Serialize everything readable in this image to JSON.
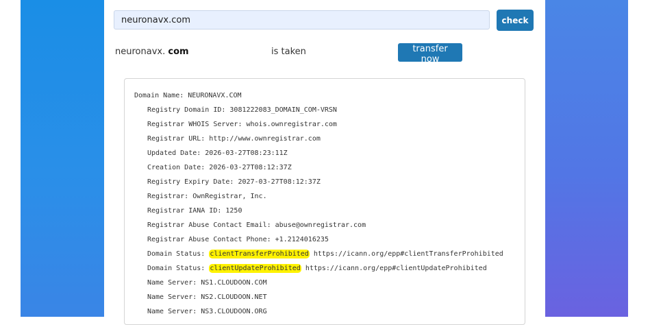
{
  "search": {
    "value": "neuronavx.com",
    "button_label": "check"
  },
  "result": {
    "domain_prefix": "neuronavx.",
    "domain_tld": "com",
    "status": "is taken",
    "transfer_label": "transfer now"
  },
  "whois": {
    "first_line": "Domain Name: NEURONAVX.COM",
    "lines": [
      "Registry Domain ID: 3081222083_DOMAIN_COM-VRSN",
      "Registrar WHOIS Server: whois.ownregistrar.com",
      "Registrar URL: http://www.ownregistrar.com",
      "Updated Date: 2026-03-27T08:23:11Z",
      "Creation Date: 2026-03-27T08:12:37Z",
      "Registry Expiry Date: 2027-03-27T08:12:37Z",
      "Registrar: OwnRegistrar, Inc.",
      "Registrar IANA ID: 1250",
      "Registrar Abuse Contact Email: abuse@ownregistrar.com",
      "Registrar Abuse Contact Phone: +1.2124016235"
    ],
    "status_lines": [
      {
        "label": "Domain Status:",
        "code": "clientTransferProhibited",
        "url": "https://icann.org/epp#clientTransferProhibited"
      },
      {
        "label": "Domain Status:",
        "code": "clientUpdateProhibited",
        "url": "https://icann.org/epp#clientUpdateProhibited"
      }
    ],
    "name_servers": [
      "Name Server: NS1.CLOUDOON.COM",
      "Name Server: NS2.CLOUDOON.NET",
      "Name Server: NS3.CLOUDOON.ORG"
    ]
  },
  "colors": {
    "accent_button": "#1f78b4",
    "highlight": "#fff200",
    "left_gradient": "#1a8ee6",
    "right_gradient": "#6a62e0"
  }
}
